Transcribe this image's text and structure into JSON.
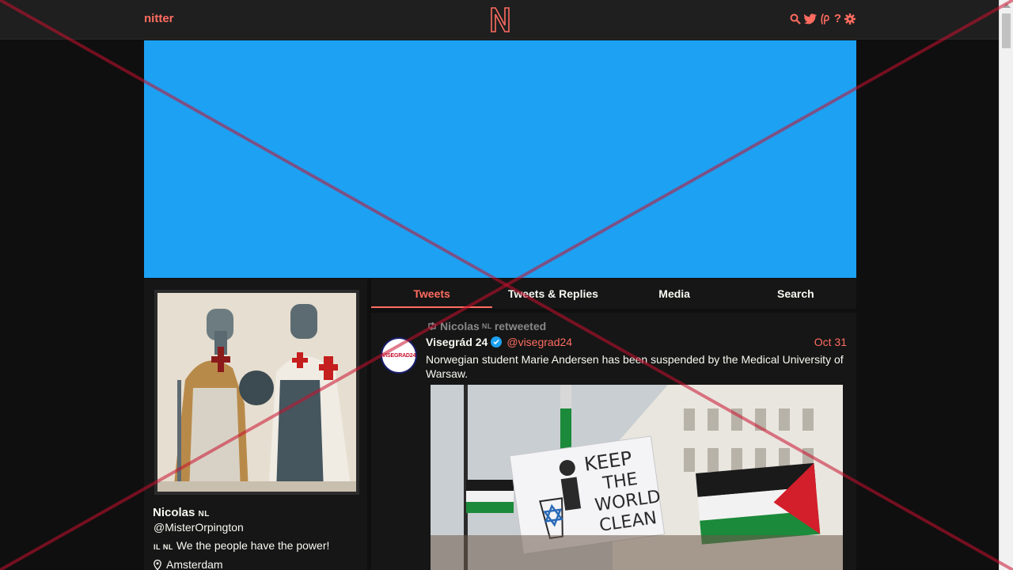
{
  "navbar": {
    "brand": "nitter",
    "logo_letter": "N",
    "icons": [
      "search-icon",
      "twitter-bird-icon",
      "instance-icon",
      "help-icon",
      "gear-icon"
    ]
  },
  "colors": {
    "accent": "#ff6c60",
    "banner": "#1da1f2",
    "background": "#0f0f0f",
    "panel": "#161616",
    "navbar": "#1f1f1f"
  },
  "profile": {
    "fullname": "Nicolas",
    "fullname_flag": "NL",
    "username": "@MisterOrpington",
    "bio_flags": "IL NL",
    "bio": "We the people have the power!",
    "location": "Amsterdam"
  },
  "tabs": [
    {
      "label": "Tweets",
      "active": true
    },
    {
      "label": "Tweets & Replies",
      "active": false
    },
    {
      "label": "Media",
      "active": false
    },
    {
      "label": "Search",
      "active": false
    }
  ],
  "tweet": {
    "retweeter": "Nicolas",
    "retweeter_flag": "NL",
    "retweet_label": "retweeted",
    "avatar_text": "VISEGRAD24",
    "fullname": "Visegrád 24",
    "username": "@visegrad24",
    "date": "Oct 31",
    "text": "Norwegian student Marie Andersen has been suspended by the Medical University of Warsaw.",
    "sign_text": [
      "KEEP",
      "THE",
      "WORLD",
      "CLEAN"
    ]
  }
}
